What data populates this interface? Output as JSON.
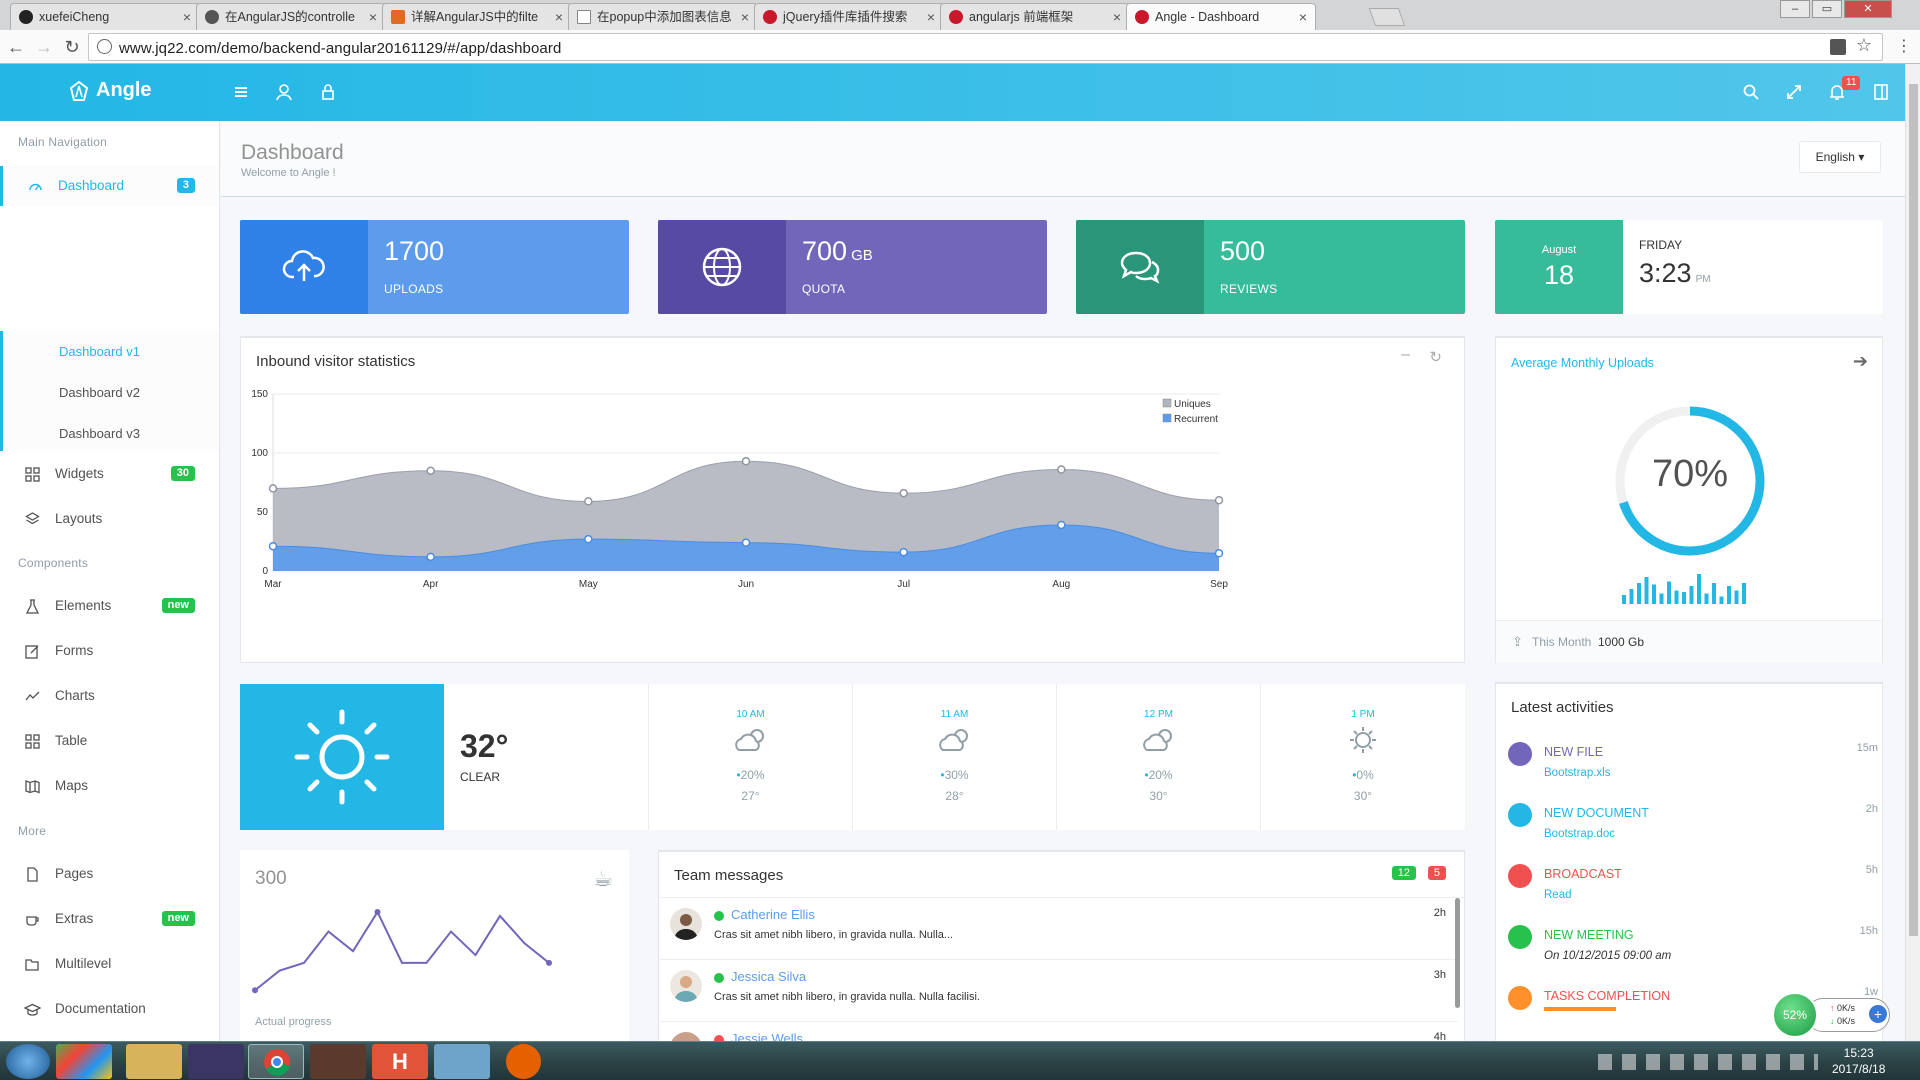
{
  "browser": {
    "tabs": [
      {
        "title": "xuefeiCheng",
        "active": false
      },
      {
        "title": "在AngularJS的controlle",
        "active": false
      },
      {
        "title": "详解AngularJS中的filte",
        "active": false
      },
      {
        "title": "在popup中添加图表信息",
        "active": false
      },
      {
        "title": "jQuery插件库插件搜索",
        "active": false
      },
      {
        "title": "angularjs 前端框架",
        "active": false
      },
      {
        "title": "Angle - Dashboard",
        "active": true
      }
    ],
    "url": "www.jq22.com/demo/backend-angular20161129/#/app/dashboard"
  },
  "app": {
    "brand": "Angle",
    "notification_count": "11"
  },
  "sidebar": {
    "main_heading": "Main Navigation",
    "components_heading": "Components",
    "more_heading": "More",
    "dashboard": {
      "label": "Dashboard",
      "badge": "3"
    },
    "dashboard_sub": [
      "Dashboard v1",
      "Dashboard v2",
      "Dashboard v3"
    ],
    "widgets": {
      "label": "Widgets",
      "badge": "30"
    },
    "layouts": {
      "label": "Layouts"
    },
    "elements": {
      "label": "Elements",
      "badge": "new"
    },
    "forms": {
      "label": "Forms"
    },
    "charts": {
      "label": "Charts"
    },
    "table": {
      "label": "Table"
    },
    "maps": {
      "label": "Maps"
    },
    "pages": {
      "label": "Pages"
    },
    "extras": {
      "label": "Extras",
      "badge": "new"
    },
    "multilevel": {
      "label": "Multilevel"
    },
    "documentation": {
      "label": "Documentation"
    }
  },
  "page": {
    "title": "Dashboard",
    "subtitle": "Welcome to Angle !",
    "language": "English"
  },
  "stats": {
    "uploads": {
      "value": "1700",
      "label": "UPLOADS",
      "color": "#5d9cec"
    },
    "quota": {
      "value": "700",
      "unit": "GB",
      "label": "QUOTA",
      "color": "#7266ba"
    },
    "reviews": {
      "value": "500",
      "label": "REVIEWS",
      "color": "#37bc9b"
    },
    "date": {
      "month": "August",
      "day": "18",
      "weekday": "FRIDAY",
      "time": "3:23",
      "ampm": "PM"
    }
  },
  "visitor_panel": {
    "title": "Inbound visitor statistics"
  },
  "chart_data": {
    "type": "area",
    "title": "Inbound visitor statistics",
    "categories": [
      "Mar",
      "Apr",
      "May",
      "Jun",
      "Jul",
      "Aug",
      "Sep"
    ],
    "ylim": [
      0,
      150
    ],
    "yticks": [
      0,
      50,
      100,
      150
    ],
    "legend": "top-right",
    "series": [
      {
        "name": "Uniques",
        "color": "#b1b4bf",
        "values": [
          70,
          85,
          59,
          93,
          66,
          86,
          60
        ]
      },
      {
        "name": "Recurrent",
        "color": "#5d9cec",
        "values": [
          21,
          12,
          27,
          24,
          16,
          39,
          15
        ]
      }
    ]
  },
  "uploads_panel": {
    "title": "Average Monthly Uploads",
    "percent": "70%",
    "percent_value": 0.7,
    "bars": [
      6,
      10,
      14,
      18,
      13,
      7,
      15,
      9,
      8,
      12,
      20,
      7,
      14,
      5,
      12,
      9,
      14
    ],
    "footer_label": "This Month",
    "footer_value": "1000 Gb"
  },
  "weather": {
    "temp": "32°",
    "cond": "CLEAR",
    "hours": [
      {
        "time": "10 AM",
        "rain": "20%",
        "temp": "27°"
      },
      {
        "time": "11 AM",
        "rain": "30%",
        "temp": "28°"
      },
      {
        "time": "12 PM",
        "rain": "20%",
        "temp": "30°"
      },
      {
        "time": "1 PM",
        "rain": "0%",
        "temp": "30°"
      }
    ]
  },
  "progress_panel": {
    "value": "300",
    "label": "Actual progress",
    "line": [
      3,
      8,
      10,
      18,
      13,
      23,
      10,
      10,
      18,
      12,
      22,
      15,
      10
    ]
  },
  "team": {
    "title": "Team messages",
    "badge_green": "12",
    "badge_red": "5",
    "messages": [
      {
        "name": "Catherine Ellis",
        "text": "Cras sit amet nibh libero, in gravida nulla. Nulla...",
        "time": "2h"
      },
      {
        "name": "Jessica Silva",
        "text": "Cras sit amet nibh libero, in gravida nulla. Nulla facilisi.",
        "time": "3h"
      },
      {
        "name": "Jessie Wells",
        "text": "",
        "time": "4h"
      }
    ]
  },
  "activities": {
    "title": "Latest activities",
    "items": [
      {
        "title": "NEW FILE",
        "sub": "Bootstrap.xls",
        "time": "15m",
        "color": "#7266ba"
      },
      {
        "title": "NEW DOCUMENT",
        "sub": "Bootstrap.doc",
        "time": "2h",
        "color": "#23b7e5"
      },
      {
        "title": "BROADCAST",
        "sub": "Read",
        "time": "5h",
        "color": "#f05050"
      },
      {
        "title": "NEW MEETING",
        "sub": "On 10/12/2015 09:00 am",
        "time": "15h",
        "color": "#27c24c"
      },
      {
        "title": "TASKS COMPLETION",
        "sub": "",
        "time": "1w",
        "color": "#ff902b"
      }
    ]
  },
  "netmeter": {
    "percent": "52%",
    "up": "0K/s",
    "down": "0K/s"
  },
  "taskbar": {
    "time": "15:23",
    "date": "2017/8/18"
  }
}
